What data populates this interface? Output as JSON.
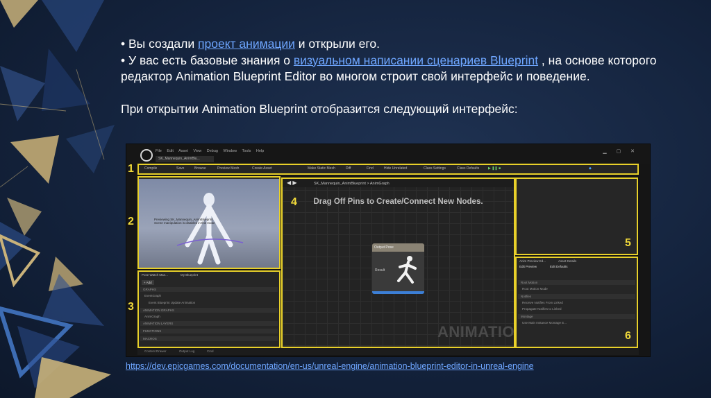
{
  "slide": {
    "bullet1": {
      "prefix": "• Вы создали ",
      "link": "проект анимации",
      "suffix": " и открыли его."
    },
    "bullet2": {
      "prefix": "• У вас есть базовые знания о ",
      "link": "визуальном написании сценариев Blueprint",
      "suffix": " , на основе которого редактор Animation Blueprint Editor во многом строит свой интерфейс и поведение."
    },
    "intro": "При открытии Animation Blueprint отобразится следующий интерфейс:",
    "source_url": "https://dev.epicgames.com/documentation/en-us/unreal-engine/animation-blueprint-editor-in-unreal-engine"
  },
  "editor": {
    "menu": [
      "File",
      "Edit",
      "Asset",
      "View",
      "Debug",
      "Window",
      "Tools",
      "Help"
    ],
    "tab": "SK_Mannequin_AnimBlu...",
    "toolbar": [
      "Compile",
      "Save",
      "Browse",
      "Preview Mesh",
      "Create Asset",
      "Make Static Mesh",
      "Diff",
      "Find",
      "Hide Unrelated",
      "Class Settings",
      "Class Defaults"
    ],
    "breadcrumb": "SK_Mannequin_AnimBlueprint  >  AnimGraph",
    "graph_hint": "Drag Off Pins to Create/Connect New Nodes.",
    "graph_watermark": "ANIMATION",
    "node": {
      "title": "Output Pose",
      "pin": "Result"
    },
    "left_panel": {
      "tabs": [
        "Pose Watch Man...",
        "My Blueprint"
      ],
      "add_label": "+ Add",
      "rows": [
        "GRAPHS",
        "EventGraph",
        "Event Blueprint Update Animation",
        "ANIMATION GRAPHS",
        "AnimGraph",
        "ANIMATION LAYERS",
        "FUNCTIONS",
        "MACROS"
      ]
    },
    "details_panel": {
      "tabs": [
        "Anim Preview Ed...",
        "Asset Details"
      ],
      "buttons": [
        "Edit Preview",
        "Edit Defaults"
      ],
      "rows": [
        "Root Motion",
        "Root Motion Mode",
        "Notifies",
        "Receive Notifies From Linked",
        "Propagate Notifies to Linked",
        "Montage",
        "Use Main Instance Montage E..."
      ]
    },
    "status": [
      "Content Drawer",
      "Output Log",
      "Cmd"
    ],
    "region_numbers": [
      "1",
      "2",
      "3",
      "4",
      "5",
      "6"
    ]
  },
  "colors": {
    "highlight": "#e8d02a",
    "link": "#6ea6ff",
    "background": "#14233d"
  }
}
